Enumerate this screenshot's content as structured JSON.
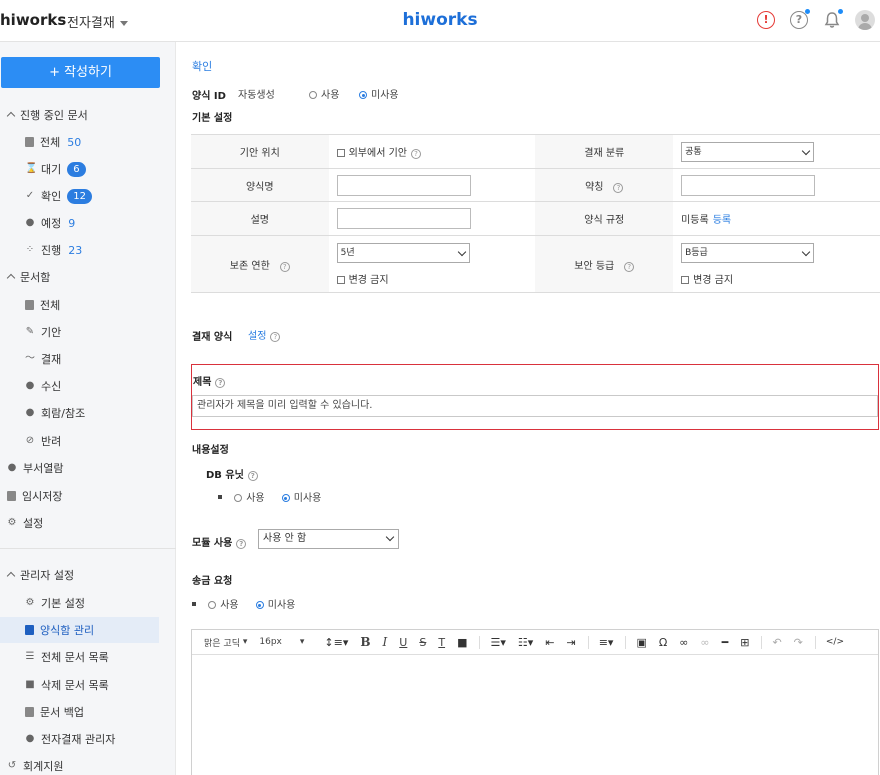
{
  "header": {
    "brand": "hiworks",
    "app_name": "전자결재",
    "center_logo": "hiworks",
    "alert_icon_glyph": "!",
    "help_icon_glyph": "?"
  },
  "sidebar": {
    "compose_label": "+ 작성하기",
    "section_in_progress": "진행 중인 문서",
    "in_progress_items": [
      {
        "label": "전체",
        "count": "50"
      },
      {
        "label": "대기",
        "count": "6"
      },
      {
        "label": "확인",
        "count": "12"
      },
      {
        "label": "예정",
        "count": "9"
      },
      {
        "label": "진행",
        "count": "23"
      }
    ],
    "section_docbox": "문서함",
    "docbox_items": [
      {
        "label": "전체"
      },
      {
        "label": "기안"
      },
      {
        "label": "결재"
      },
      {
        "label": "수신"
      },
      {
        "label": "회람/참조"
      },
      {
        "label": "반려"
      }
    ],
    "dept_view": "부서열람",
    "temp_save": "임시저장",
    "settings": "설정",
    "section_admin": "관리자 설정",
    "admin_items": [
      {
        "label": "기본 설정"
      },
      {
        "label": "양식함 관리"
      },
      {
        "label": "전체 문서 목록"
      },
      {
        "label": "삭제 문서 목록"
      },
      {
        "label": "문서 백업"
      },
      {
        "label": "전자결재 관리자"
      }
    ],
    "accounting": "회계지원"
  },
  "main": {
    "confirm_link": "확인",
    "form_id_label": "양식 ID",
    "auto_gen": "자동생성",
    "use": "사용",
    "not_use": "미사용",
    "basic_settings": "기본 설정",
    "help_glyph": "?",
    "table": {
      "draft_location": "기안 위치",
      "external_draft": "외부에서 기안",
      "approval_category": "결재 분류",
      "approval_category_value": "공통",
      "form_name": "양식명",
      "abbreviation": "약칭",
      "description": "설명",
      "form_rule": "양식 규정",
      "unregistered": "미등록",
      "register": "등록",
      "retention": "보존 연한",
      "retention_value": "5년",
      "no_change": "변경 금지",
      "security_level": "보안 등급",
      "security_value": "B등급"
    },
    "approval_form": "결재 양식",
    "approval_form_setting": "설정",
    "title_label": "제목",
    "title_placeholder": "관리자가 제목을 미리 입력할 수 있습니다.",
    "content_settings": "내용설정",
    "db_unit": "DB 유닛",
    "module_use": "모듈 사용",
    "module_value": "사용 안 함",
    "remit_request": "송금 요청",
    "editor": {
      "font": "맑은 고딕",
      "size": "16px"
    }
  }
}
